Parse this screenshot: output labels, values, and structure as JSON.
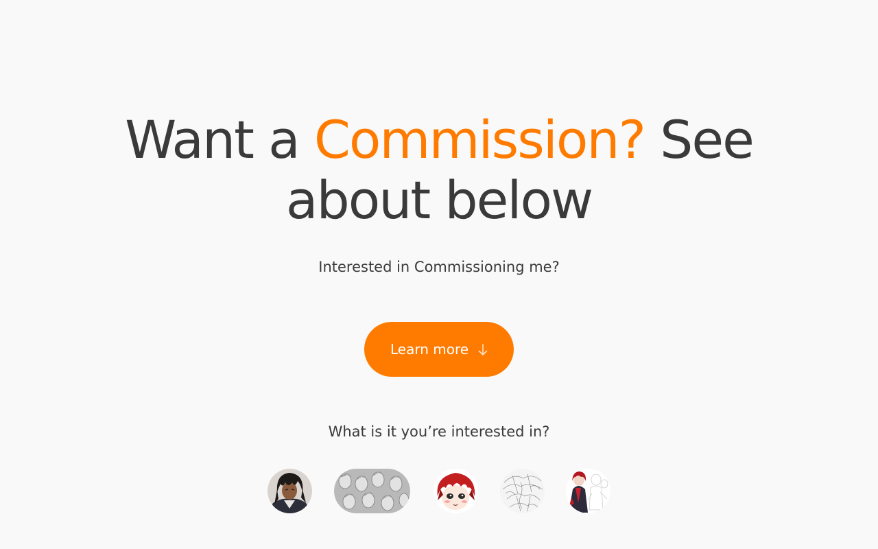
{
  "hero": {
    "title_part1": "Want a ",
    "title_accent": "Commission?",
    "title_part2": " See",
    "title_line2": "about below",
    "accent_color": "#ff7b00"
  },
  "subtitle": "Interested in Commissioning me?",
  "cta": {
    "label": "Learn more",
    "icon": "arrow-down-icon"
  },
  "question": "What is it you’re interested in?",
  "categories": [
    {
      "icon": "portrait-thumbnail"
    },
    {
      "icon": "sketch-sheet-thumbnail"
    },
    {
      "icon": "chibi-thumbnail"
    },
    {
      "icon": "lineart-thumbnail"
    },
    {
      "icon": "fullbody-thumbnail"
    }
  ]
}
